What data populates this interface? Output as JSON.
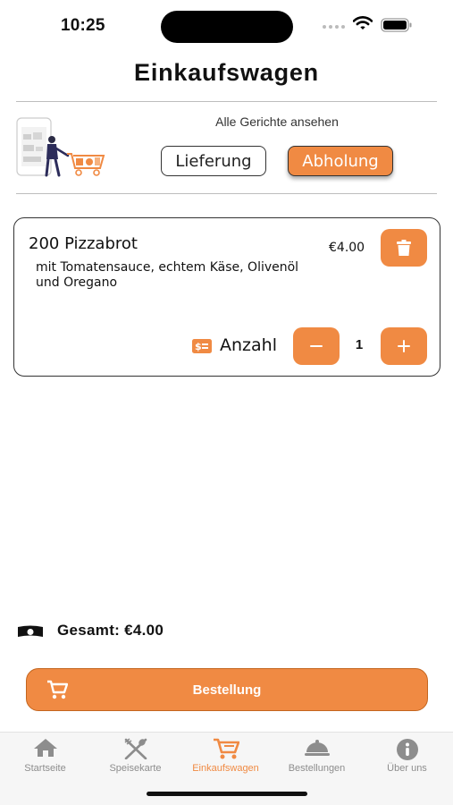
{
  "status_bar": {
    "time": "10:25"
  },
  "page": {
    "title": "Einkaufswagen"
  },
  "mode_selector": {
    "caption": "Alle Gerichte ansehen",
    "options": [
      "Lieferung",
      "Abholung"
    ],
    "selected": "Abholung"
  },
  "cart": {
    "items": [
      {
        "name": "200 Pizzabrot",
        "description": "mit Tomatensauce, echtem Käse, Olivenöl und Oregano",
        "price": "€4.00",
        "quantity_label": "Anzahl",
        "quantity": "1"
      }
    ]
  },
  "summary": {
    "total": "Gesamt: €4.00"
  },
  "order_button": {
    "label": "Bestellung"
  },
  "tabbar": {
    "tabs": [
      {
        "label": "Startseite",
        "icon": "home-icon"
      },
      {
        "label": "Speisekarte",
        "icon": "fork-knife-icon"
      },
      {
        "label": "Einkaufswagen",
        "icon": "cart-icon"
      },
      {
        "label": "Bestellungen",
        "icon": "cloche-icon"
      },
      {
        "label": "Über uns",
        "icon": "info-icon"
      }
    ],
    "active_index": 2
  },
  "colors": {
    "accent": "#f08a43",
    "tab_inactive": "#8d8d8d"
  }
}
